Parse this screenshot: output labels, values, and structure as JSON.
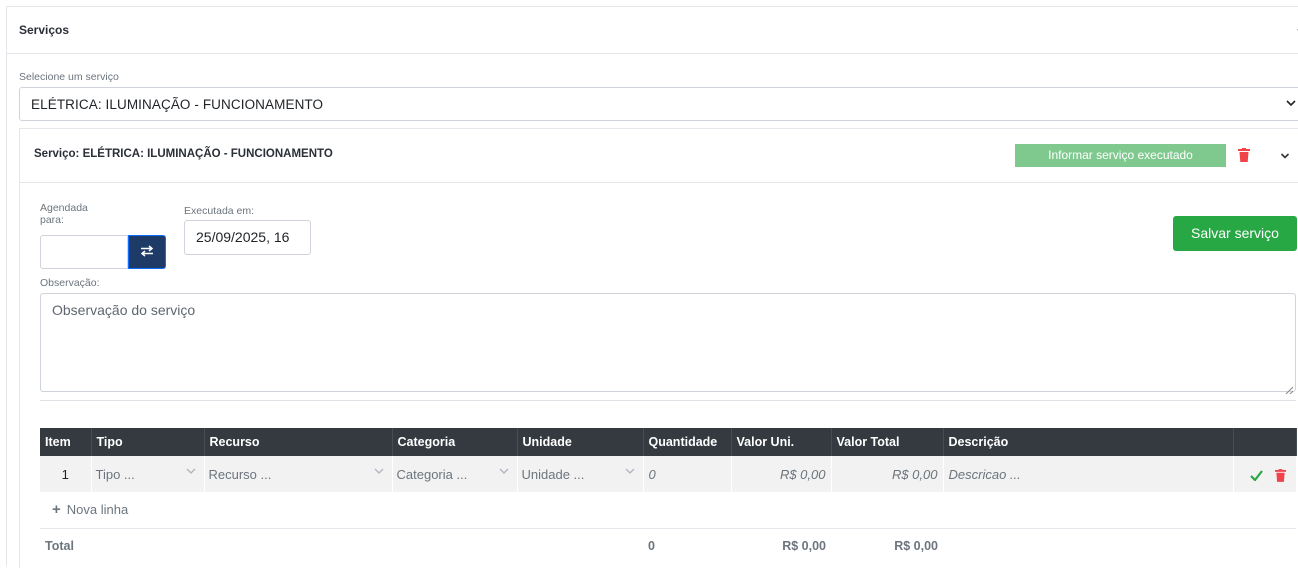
{
  "services_panel": {
    "title": "Serviços",
    "select_label": "Selecione um serviço",
    "selected_service": "ELÉTRICA: ILUMINAÇÃO - FUNCIONAMENTO"
  },
  "service_card": {
    "title": "Serviço: ELÉTRICA: ILUMINAÇÃO - FUNCIONAMENTO",
    "inform_button": "Informar serviço executado",
    "scheduled_label_line1": "Agendada",
    "scheduled_label_line2": "para:",
    "scheduled_value": "",
    "executed_label": "Executada em:",
    "executed_value": "25/09/2025, 16",
    "save_button": "Salvar serviço",
    "observation_label": "Observação:",
    "observation_placeholder": "Observação do serviço"
  },
  "table": {
    "headers": [
      "Item",
      "Tipo",
      "Recurso",
      "Categoria",
      "Unidade",
      "Quantidade",
      "Valor Uni.",
      "Valor Total",
      "Descrição"
    ],
    "row": {
      "item": "1",
      "tipo": "Tipo ...",
      "recurso": "Recurso ...",
      "categoria": "Categoria ...",
      "unidade": "Unidade ...",
      "quantidade": "0",
      "valor_uni": "R$ 0,00",
      "valor_total": "R$ 0,00",
      "descricao": "Descricao ..."
    },
    "add_line": "Nova linha",
    "total_label": "Total",
    "total_quantidade": "0",
    "total_valor_uni": "R$ 0,00",
    "total_valor_total": "R$ 0,00"
  },
  "colors": {
    "header_bg": "#343a40",
    "save_green": "#28a745",
    "inform_green_light": "#7fc98f",
    "swap_blue": "#1e3a66",
    "delete_red": "#f0434a"
  }
}
